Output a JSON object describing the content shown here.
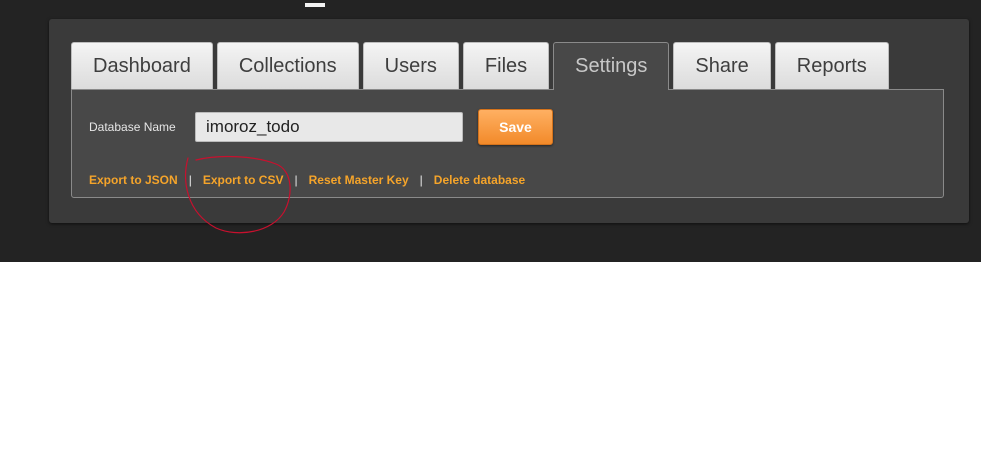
{
  "tabs": [
    {
      "label": "Dashboard",
      "active": false
    },
    {
      "label": "Collections",
      "active": false
    },
    {
      "label": "Users",
      "active": false
    },
    {
      "label": "Files",
      "active": false
    },
    {
      "label": "Settings",
      "active": true
    },
    {
      "label": "Share",
      "active": false
    },
    {
      "label": "Reports",
      "active": false
    }
  ],
  "settings": {
    "db_name_label": "Database Name",
    "db_name_value": "imoroz_todo",
    "save_label": "Save"
  },
  "actions": {
    "export_json": "Export to JSON",
    "separator": "|",
    "export_csv": "Export to CSV",
    "reset_master_key": "Reset Master Key",
    "delete_database": "Delete database"
  },
  "colors": {
    "background_dark": "#232323",
    "panel": "#3a3a3a",
    "content": "#484848",
    "accent_orange": "#f28a2a",
    "link_orange": "#f5a42a",
    "annotation_red": "#c8102e"
  }
}
